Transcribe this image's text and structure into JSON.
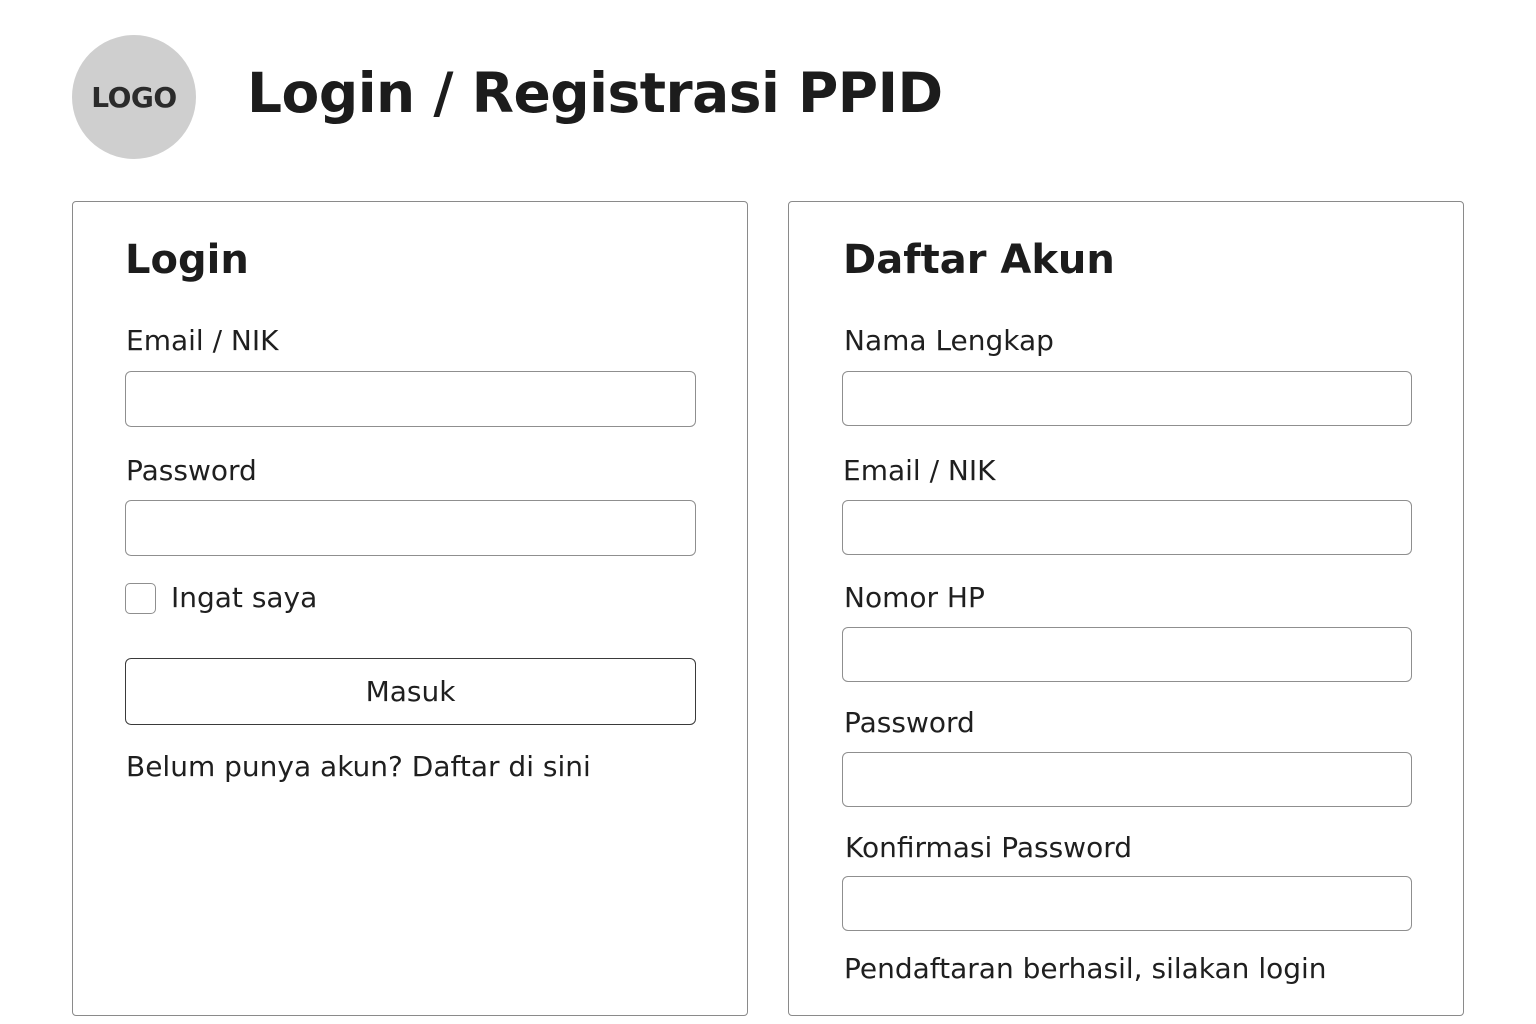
{
  "header": {
    "logo_text": "LOGO",
    "title": "Login / Registrasi PPID"
  },
  "login": {
    "title": "Login",
    "email_label": "Email / NIK",
    "email_value": "",
    "password_label": "Password",
    "password_value": "",
    "remember_label": "Ingat saya",
    "remember_checked": false,
    "submit_label": "Masuk",
    "register_link": "Belum punya akun? Daftar di sini"
  },
  "register": {
    "title": "Daftar Akun",
    "fields": [
      {
        "label": "Nama Lengkap",
        "value": ""
      },
      {
        "label": "Email / NIK",
        "value": ""
      },
      {
        "label": "Nomor HP",
        "value": ""
      },
      {
        "label": "Password",
        "value": ""
      },
      {
        "label": "Konfirmasi Password",
        "value": ""
      }
    ],
    "status_message": "Pendaftaran berhasil, silakan login"
  },
  "colors": {
    "background": "#ffffff",
    "border": "#8a8a8a",
    "logo_fill": "#cfcfcf",
    "text": "#1f1f1f"
  }
}
